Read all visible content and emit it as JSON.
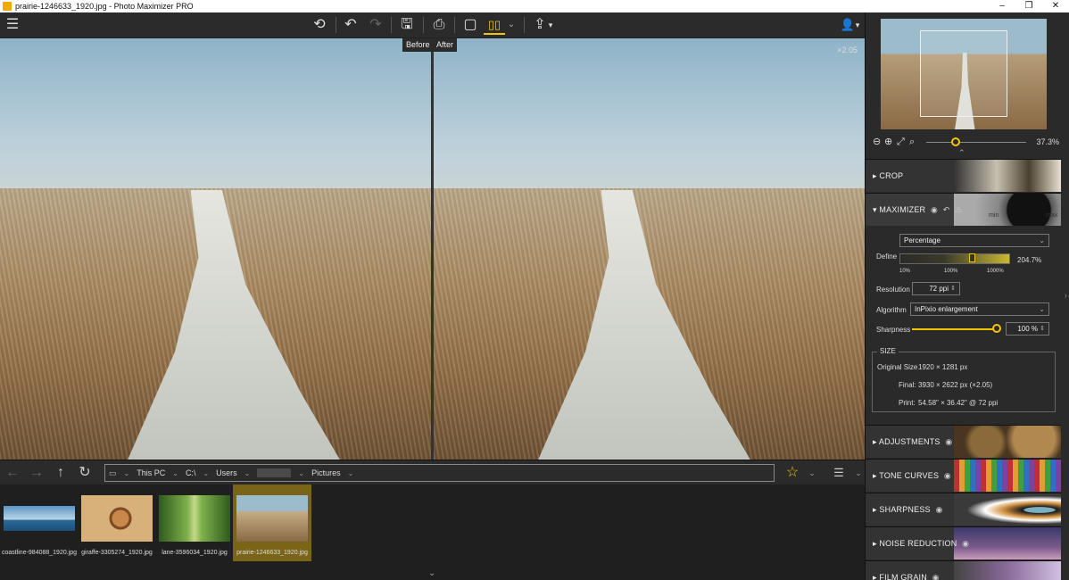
{
  "window": {
    "title": "prairie-1246633_1920.jpg - Photo Maximizer PRO",
    "min": "–",
    "max": "❐",
    "close": "✕"
  },
  "toolbar": {
    "menu_icon": "☰",
    "undo_all_icon": "⟲",
    "undo_icon": "↶",
    "redo_icon": "↷",
    "save_icon": "🖫",
    "print_icon": "⎙",
    "single_view_icon": "▢",
    "split_view_icon": "▯▯",
    "split_dropdown": "⌄",
    "share_icon": "⇪",
    "share_dropdown": "▾",
    "user_icon": "👤",
    "user_dropdown": "▾"
  },
  "compare": {
    "before_label": "Before",
    "after_label": "After",
    "zoom_factor": "×2.05"
  },
  "navigation": {
    "back_icon": "←",
    "forward_icon": "→",
    "up_icon": "↑",
    "refresh_icon": "↻",
    "folder_icon": "▭",
    "crumbs": [
      "This PC",
      "C:\\",
      "Users",
      "Pictures"
    ],
    "favorite_icon": "☆",
    "sort_icon": "☰",
    "dropdown": "⌄"
  },
  "filmstrip": {
    "items": [
      {
        "name": "coastline-984088_1920.jpg",
        "selected": false
      },
      {
        "name": "giraffe-3305274_1920.jpg",
        "selected": false
      },
      {
        "name": "lane-3596034_1920.jpg",
        "selected": false
      },
      {
        "name": "prairie-1246633_1920.jpg",
        "selected": true
      }
    ],
    "collapse_icon": "⌄"
  },
  "navigator": {
    "zoom_out_icon": "⊖",
    "zoom_in_icon": "⊕",
    "fit_icon": "⤢",
    "actual_icon": "⌕",
    "zoom_value": "37.3%",
    "zoom_fraction": 0.373,
    "collapse_icon": "⌃"
  },
  "sections": {
    "crop": "CROP",
    "maximizer": "MAXIMIZER",
    "adjustments": "ADJUSTMENTS",
    "tone_curves": "TONE CURVES",
    "sharpness": "SHARPNESS",
    "noise_reduction": "NOISE REDUCTION",
    "film_grain": "FILM GRAIN"
  },
  "maximizer": {
    "dial_min": "min",
    "dial_max": "max",
    "mode": "Percentage",
    "define_label": "Define",
    "define_value": "204.7%",
    "scale_ticks": [
      "10%",
      "100%",
      "1000%"
    ],
    "resolution_label": "Resolution",
    "resolution_value": "72 ppi",
    "algorithm_label": "Algorithm",
    "algorithm_value": "InPixio enlargement",
    "sharpness_label": "Sharpness",
    "sharpness_value": "100 %",
    "sharpness_fraction": 1.0
  },
  "size": {
    "title": "SIZE",
    "original_label": "Original Size",
    "original_value": "1920 × 1281 px",
    "final_label": "Final:",
    "final_value": "3930 × 2622 px (×2.05)",
    "print_label": "Print:",
    "print_value": "54.58\" × 36.42\" @ 72 ppi"
  },
  "colors": {
    "accent": "#f5c400",
    "panel": "#2a2a2a",
    "selected_thumb": "#7a6418"
  }
}
